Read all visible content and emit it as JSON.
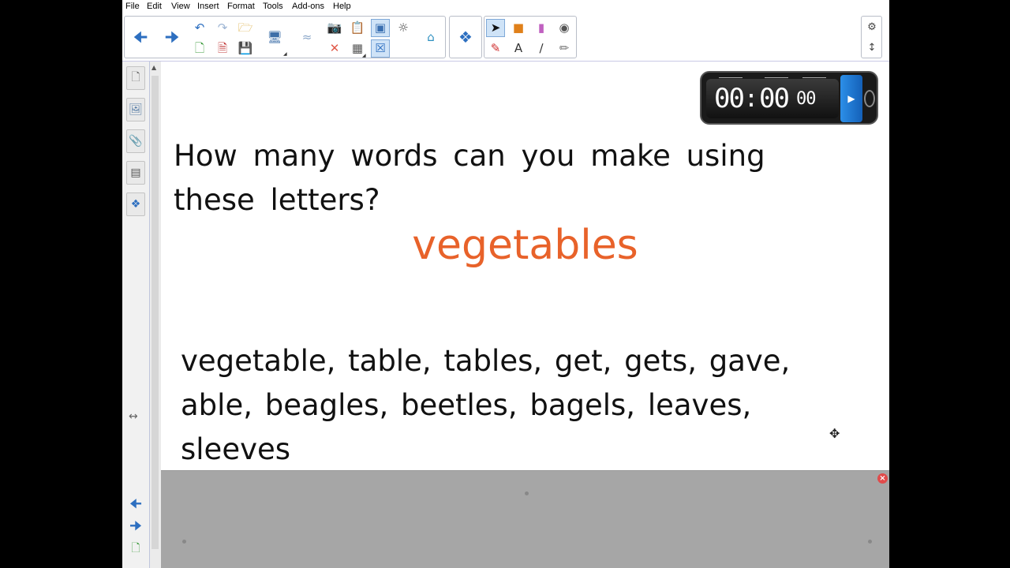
{
  "menu": [
    "File",
    "Edit",
    "View",
    "Insert",
    "Format",
    "Tools",
    "Add-ons",
    "Help"
  ],
  "page": {
    "question": "How many words can you make using these letters?",
    "keyword": "vegetables",
    "answer": "vegetable, table, tables, get, gets, gave, able, beagles, beetles, bagels, leaves, sleeves"
  },
  "timer": {
    "minutes": "00",
    "seconds": "00",
    "centiseconds": "00"
  },
  "colors": {
    "keyword": "#e8622a",
    "panel": "#a6a6a6",
    "accent": "#2d6fc0"
  }
}
